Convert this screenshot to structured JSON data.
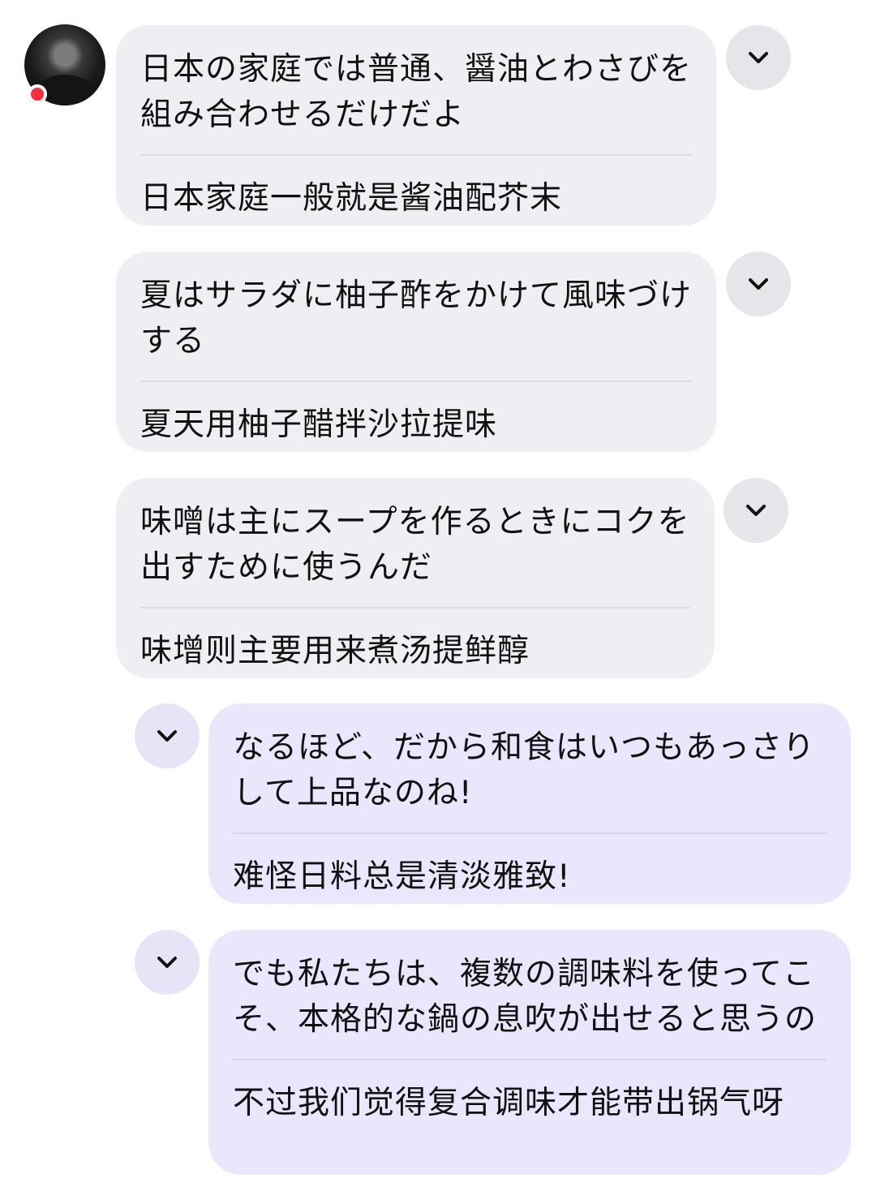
{
  "contact": {
    "avatar_icon": "avatar-photo",
    "status": "online-indicator"
  },
  "messages": [
    {
      "side": "in",
      "original": "日本の家庭では普通、醤油とわさびを組み合わせるだけだよ",
      "translation": "日本家庭一般就是酱油配芥末"
    },
    {
      "side": "in",
      "original": "夏はサラダに柚子酢をかけて風味づけする",
      "translation": "夏天用柚子醋拌沙拉提味"
    },
    {
      "side": "in",
      "original": "味噌は主にスープを作るときにコクを出すために使うんだ",
      "translation": "味增则主要用来煮汤提鲜醇"
    },
    {
      "side": "out",
      "original": "なるほど、だから和食はいつもあっさりして上品なのね!",
      "translation": "难怪日料总是清淡雅致!"
    },
    {
      "side": "out",
      "original": "でも私たちは、複数の調味料を使ってこそ、本格的な鍋の息吹が出せると思うの",
      "translation": "不过我们觉得复合调味才能带出锅气呀"
    }
  ],
  "icons": {
    "toggle": "chevron-down-icon"
  },
  "colors": {
    "incoming_bubble": "#efeff3",
    "outgoing_bubble": "#e9e7fb",
    "status_dot": "#ff2d3c"
  }
}
